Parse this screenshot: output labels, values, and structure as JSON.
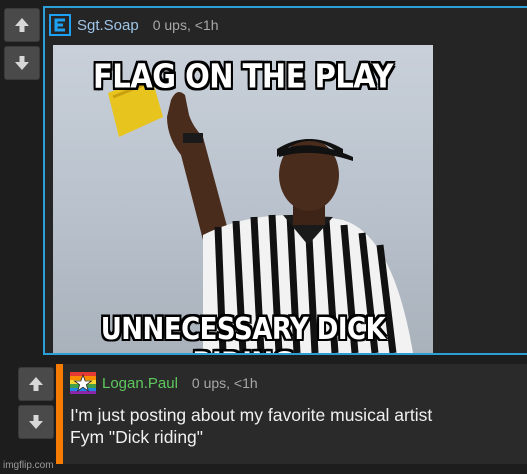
{
  "comment1": {
    "username": "Sgt.Soap",
    "meta": "0 ups, <1h",
    "meme": {
      "top_text": "FLAG ON THE PLAY",
      "bottom_text": "UNNECESSARY DICK RIDING"
    }
  },
  "comment2": {
    "username": "Logan.Paul",
    "meta": "0 ups, <1h",
    "body_line1": "I'm just posting about my favorite musical artist",
    "body_line2": "Fym \"Dick riding\""
  },
  "footer": {
    "watermark": "imgflip.com"
  },
  "colors": {
    "accent_blue": "#2b9fd6",
    "accent_orange": "#f57c00",
    "username_blue": "#9ec5e8",
    "username_green": "#5ec95e"
  }
}
